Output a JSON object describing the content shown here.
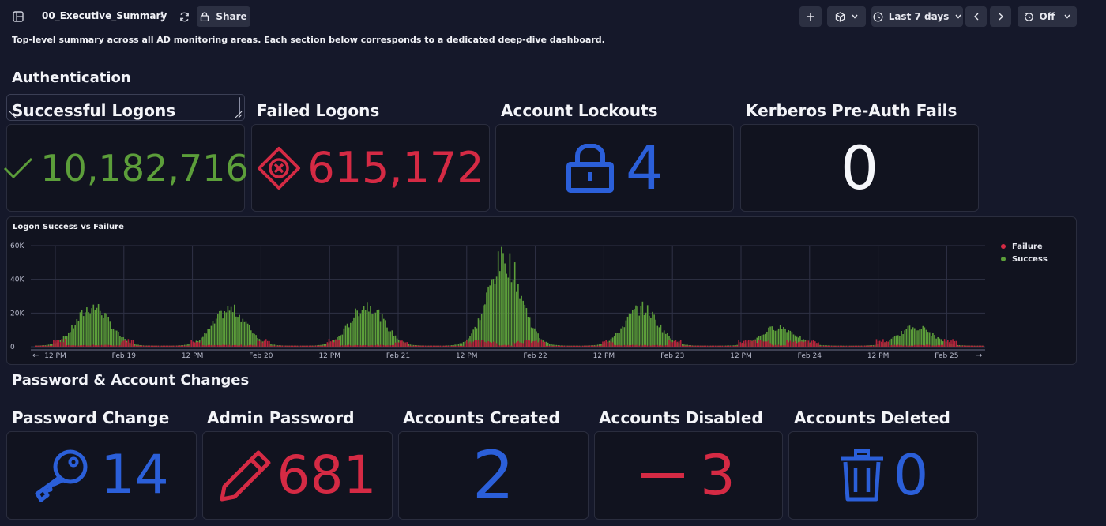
{
  "toolbar": {
    "dashboard_title": "00_Executive_Summary",
    "share_label": "Share",
    "time_range": "Last 7 days",
    "refresh_label": "Off"
  },
  "description": "Top-level summary across all AD monitoring areas. Each section below corresponds to a dedicated deep-dive dashboard.",
  "sections": {
    "authentication": "Authentication",
    "password": "Password & Account Changes"
  },
  "auth_tiles": [
    {
      "label": "Successful Logons",
      "value": "10,182,716",
      "icon": "check-icon",
      "color": "#5c9e3a"
    },
    {
      "label": "Failed Logons",
      "value": "615,172",
      "icon": "x-diamond-icon",
      "color": "#d52a44"
    },
    {
      "label": "Account Lockouts",
      "value": "4",
      "icon": "lock-icon",
      "color": "#2b5fd9"
    },
    {
      "label": "Kerberos Pre-Auth Fails",
      "value": "0",
      "icon": "",
      "color": "#f5f6fa"
    }
  ],
  "password_tiles": [
    {
      "label": "Password Change",
      "value": "14",
      "icon": "key-icon",
      "color": "#2b5fd9"
    },
    {
      "label": "Admin Password",
      "value": "681",
      "icon": "pencil-icon",
      "color": "#d52a44"
    },
    {
      "label": "Accounts Created",
      "value": "2",
      "icon": "",
      "color": "#2b5fd9"
    },
    {
      "label": "Accounts Disabled",
      "value": "3",
      "icon": "minus-icon",
      "color": "#d52a44"
    },
    {
      "label": "Accounts Deleted",
      "value": "0",
      "icon": "trash-icon",
      "color": "#2b5fd9"
    }
  ],
  "chart_data": {
    "type": "bar",
    "title": "Logon Success vs Failure",
    "stacked": true,
    "x_ticks": [
      "12 PM",
      "Feb 19",
      "12 PM",
      "Feb 20",
      "12 PM",
      "Feb 21",
      "12 PM",
      "Feb 22",
      "12 PM",
      "Feb 23",
      "12 PM",
      "Feb 24",
      "12 PM",
      "Feb 25"
    ],
    "y_ticks": [
      "0",
      "20K",
      "40K",
      "60K"
    ],
    "ylim": [
      0,
      60000
    ],
    "grid": true,
    "legend_position": "right",
    "series": [
      {
        "name": "Failure",
        "color": "#d52a44"
      },
      {
        "name": "Success",
        "color": "#5c9e3a"
      }
    ],
    "daily_peaks_success": [
      {
        "day": "Feb 18-19",
        "peak": 25000
      },
      {
        "day": "Feb 19-20",
        "peak": 23000
      },
      {
        "day": "Feb 20-21",
        "peak": 26000
      },
      {
        "day": "Feb 21-22",
        "peak": 55000
      },
      {
        "day": "Feb 22-23",
        "peak": 24000
      },
      {
        "day": "Feb 23-24",
        "peak": 12000
      },
      {
        "day": "Feb 24-25",
        "peak": 12000
      }
    ],
    "failure_level": 2500
  }
}
